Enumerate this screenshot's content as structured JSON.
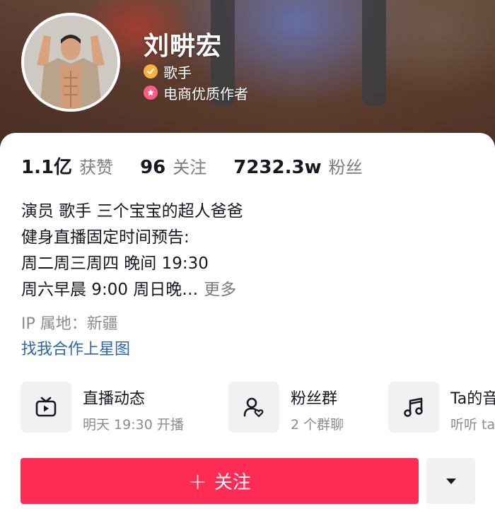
{
  "profile": {
    "name": "刘畊宏",
    "tag_singer": "歌手",
    "tag_ecommerce": "电商优质作者"
  },
  "stats": [
    {
      "value": "1.1亿",
      "label": "获赞"
    },
    {
      "value": "96",
      "label": "关注"
    },
    {
      "value": "7232.3w",
      "label": "粉丝"
    }
  ],
  "bio": {
    "line1": "演员 歌手 三个宝宝的超人爸爸",
    "line2": "健身直播固定时间预告:",
    "line3": "周二周三周四 晚间 19:30",
    "line4": "周六早晨 9:00 周日晚…",
    "more": "更多"
  },
  "ip_location": "IP 属地：新疆",
  "star_link": "找我合作上星图",
  "features": [
    {
      "title": "直播动态",
      "subtitle": "明天 19:30 开播",
      "icon": "tv-icon"
    },
    {
      "title": "粉丝群",
      "subtitle": "2 个群聊",
      "icon": "fan-group-icon"
    },
    {
      "title": "Ta的音",
      "subtitle": "听听 ta",
      "icon": "music-note-icon"
    }
  ],
  "follow_label": "关注",
  "colors": {
    "accent": "#fe2c55",
    "link": "#2a66a8",
    "verified_gold": "#f5b33b",
    "badge_pink": "#fe5c85"
  }
}
